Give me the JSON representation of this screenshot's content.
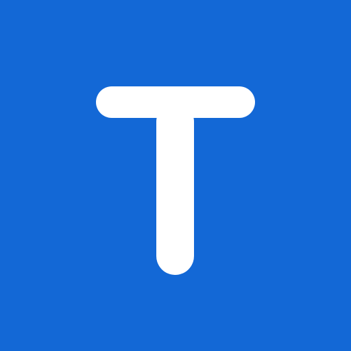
{
  "app_icon": {
    "background_color": "#1368d6",
    "glyph_color": "#ffffff",
    "glyph": "T",
    "icon_name": "letter-t-logo-icon"
  }
}
